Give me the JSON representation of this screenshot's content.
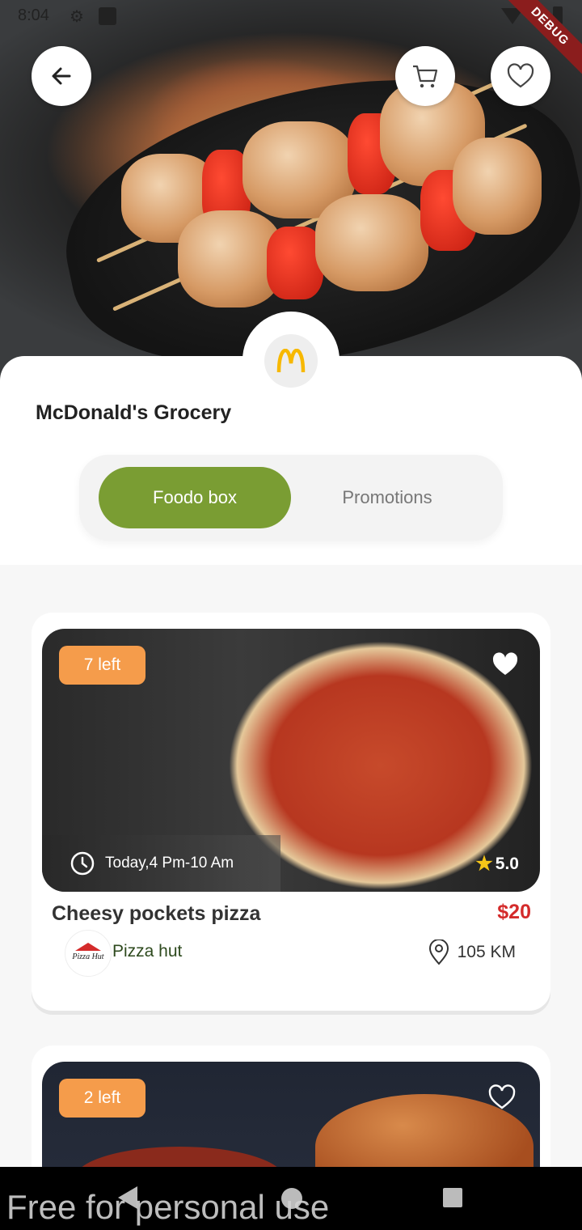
{
  "status_bar": {
    "time": "8:04"
  },
  "debug_banner": "DEBUG",
  "store": {
    "logo_letter": "M",
    "name": "McDonald's Grocery"
  },
  "tabs": [
    {
      "label": "Foodo box",
      "active": true
    },
    {
      "label": "Promotions",
      "active": false
    }
  ],
  "listings": [
    {
      "stock_label": "7 left",
      "pickup_time": "Today,4 Pm-10 Am",
      "rating": "5.0",
      "name": "Cheesy pockets pizza",
      "price": "$20",
      "vendor": "Pizza hut",
      "vendor_logo_text": "Pizza Hut",
      "distance": "105 KM"
    },
    {
      "stock_label": "2 left"
    }
  ],
  "watermark": "Free for personal use",
  "colors": {
    "accent_green": "#7a9d33",
    "badge_orange": "#f59c4b",
    "price_red": "#d42b2b"
  }
}
